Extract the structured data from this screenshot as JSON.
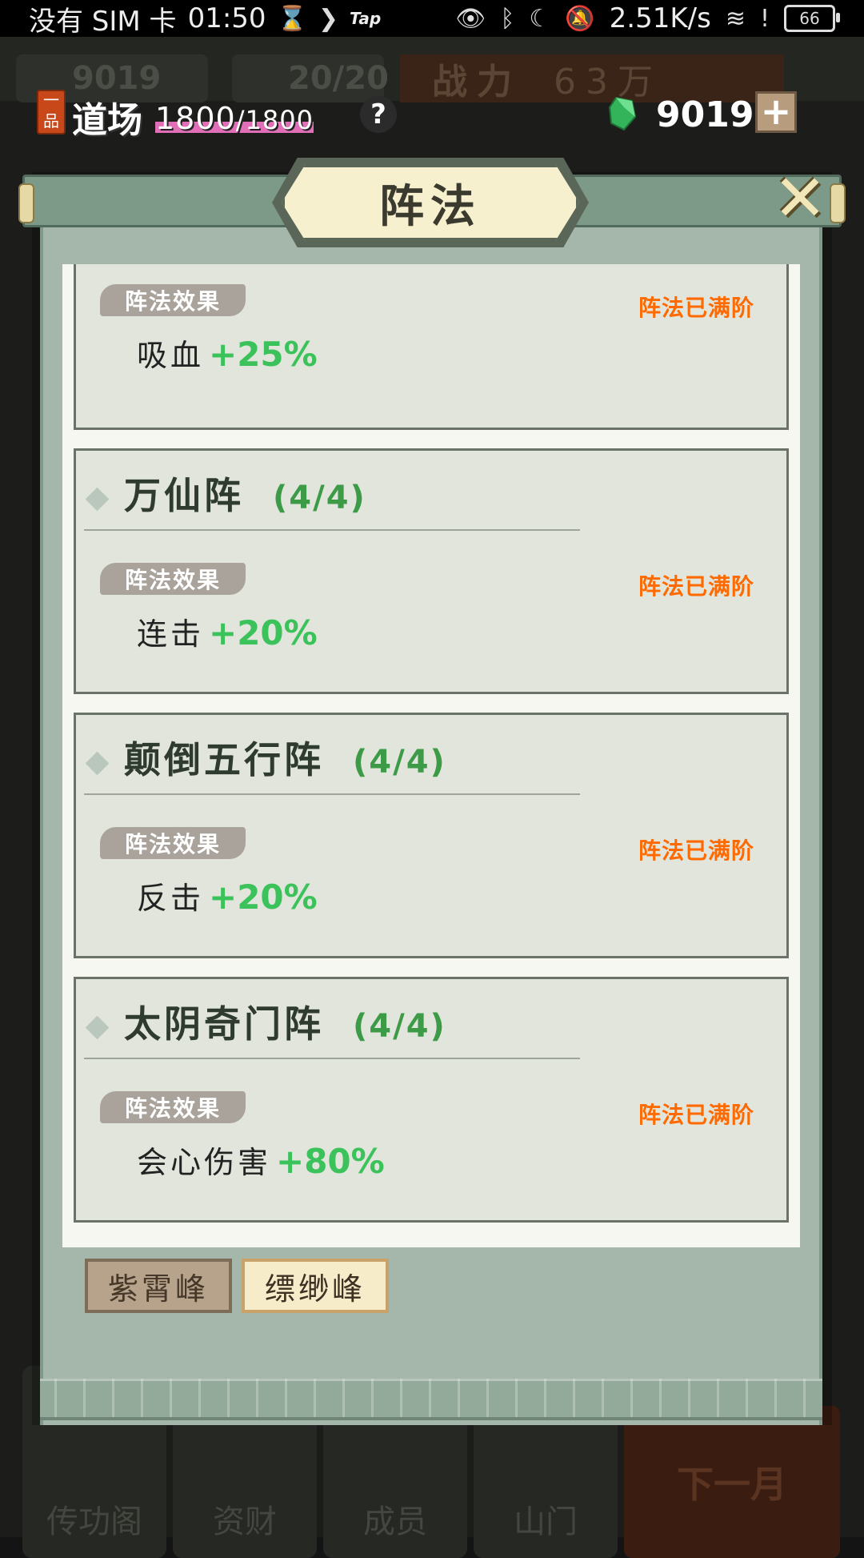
{
  "status_bar": {
    "carrier": "没有 SIM 卡",
    "time": "01:50",
    "tap_label": "Tap",
    "net_speed": "2.51K/s",
    "battery": "66"
  },
  "background": {
    "gems": "9019",
    "stamina": "20/20",
    "power_label": "战力",
    "power_value": "63万",
    "bottom_items": [
      "传功阁",
      "资财",
      "成员",
      "山门"
    ],
    "next_month": "下一月"
  },
  "hud": {
    "grade": "一品",
    "dojo_label": "道场",
    "dojo_current": "1800",
    "dojo_max": "/1800",
    "help": "?",
    "gem_count": "9019",
    "plus": "+"
  },
  "dialog": {
    "title": "阵法",
    "close": "✕",
    "effect_tag": "阵法效果",
    "maxed_label": "阵法已满阶",
    "formations": [
      {
        "name": "",
        "level": "",
        "effect": "吸血",
        "bonus": "+25%"
      },
      {
        "name": "万仙阵",
        "level": "(4/4)",
        "effect": "连击",
        "bonus": "+20%"
      },
      {
        "name": "颠倒五行阵",
        "level": "(4/4)",
        "effect": "反击",
        "bonus": "+20%"
      },
      {
        "name": "太阴奇门阵",
        "level": "(4/4)",
        "effect": "会心伤害",
        "bonus": "+80%"
      }
    ],
    "peak_tabs": [
      {
        "label": "紫霄峰",
        "selected": false
      },
      {
        "label": "缥缈峰",
        "selected": true
      }
    ]
  },
  "colors": {
    "bonus_green": "#3cc25a",
    "maxed_orange": "#ff6a00",
    "level_green": "#3d9b48",
    "dialog_green": "#a4b7aa"
  }
}
